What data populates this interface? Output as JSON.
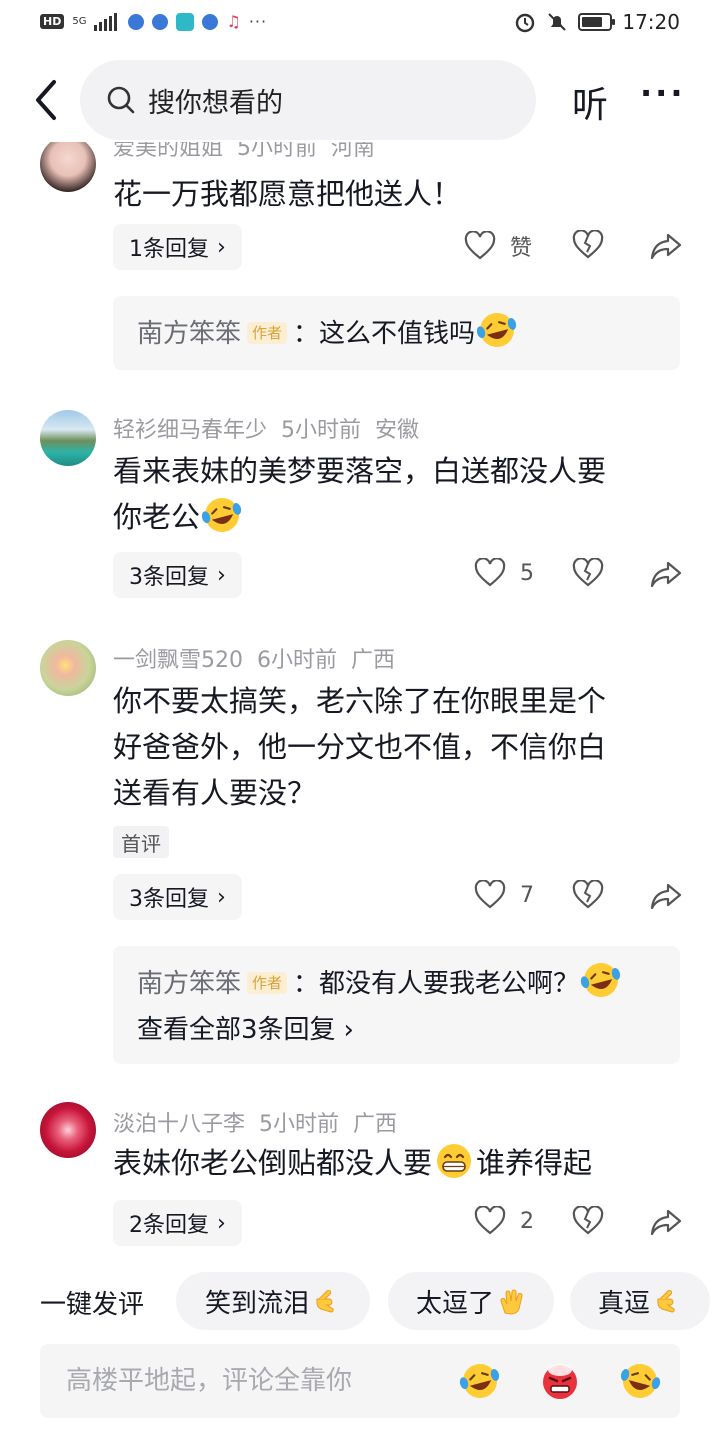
{
  "status_bar": {
    "hd": "HD",
    "signal": "5G",
    "more": "···",
    "time": "17:20",
    "battery_level": 0.75
  },
  "header": {
    "search_placeholder": "搜你想看的",
    "listen_label": "听",
    "more_label": "···"
  },
  "comments": [
    {
      "meta": [
        "爱美的姐姐",
        "5小时前",
        "河南"
      ],
      "text": "花一万我都愿意把他送人！",
      "replies_label": "1条回复",
      "likes": "赞",
      "sub_reply": {
        "author": "南方笨笨",
        "author_tag": "作者",
        "text": "：这么不值钱吗"
      }
    },
    {
      "meta": [
        "轻衫细马春年少",
        "5小时前",
        "安徽"
      ],
      "text_line1": "看来表妹的美梦要落空，白送都没人要",
      "text_line2": "你老公",
      "replies_label": "3条回复",
      "likes": "5"
    },
    {
      "meta": [
        "一剑飘雪520",
        "6小时前",
        "广西"
      ],
      "text_line1": "你不要太搞笑，老六除了在你眼里是个",
      "text_line2": "好爸爸外，他一分文也不值，不信你白",
      "text_line3": "送看有人要没？",
      "first_tag": "首评",
      "replies_label": "3条回复",
      "likes": "7",
      "sub_reply": {
        "author": "南方笨笨",
        "author_tag": "作者",
        "text": "：都没有人要我老公啊？",
        "view_all": "查看全部3条回复"
      }
    },
    {
      "meta": [
        "淡泊十八子李",
        "5小时前",
        "广西"
      ],
      "text_a": "表妹你老公倒贴都没人要",
      "text_b": "谁养得起",
      "replies_label": "2条回复",
      "likes": "2"
    }
  ],
  "quick_comment": {
    "label": "一键发评",
    "chips": [
      "笑到流泪",
      "太逗了",
      "真逗"
    ]
  },
  "input": {
    "placeholder": "高楼平地起，评论全靠你"
  },
  "colors": {
    "text": "#161823",
    "meta": "#9a9ba1",
    "bubble": "#f6f6f7",
    "author_tag_text": "#d9a43a",
    "author_tag_bg": "#fbeed3",
    "emoji_yellow": "#ffcc33",
    "emoji_red": "#e8323c"
  },
  "icons": [
    "back-icon",
    "search-icon",
    "heart-icon",
    "heartbreak-icon",
    "share-icon",
    "laugh-cry-emoji",
    "grin-emoji",
    "angry-emoji",
    "hand-emoji",
    "clap-emoji"
  ]
}
